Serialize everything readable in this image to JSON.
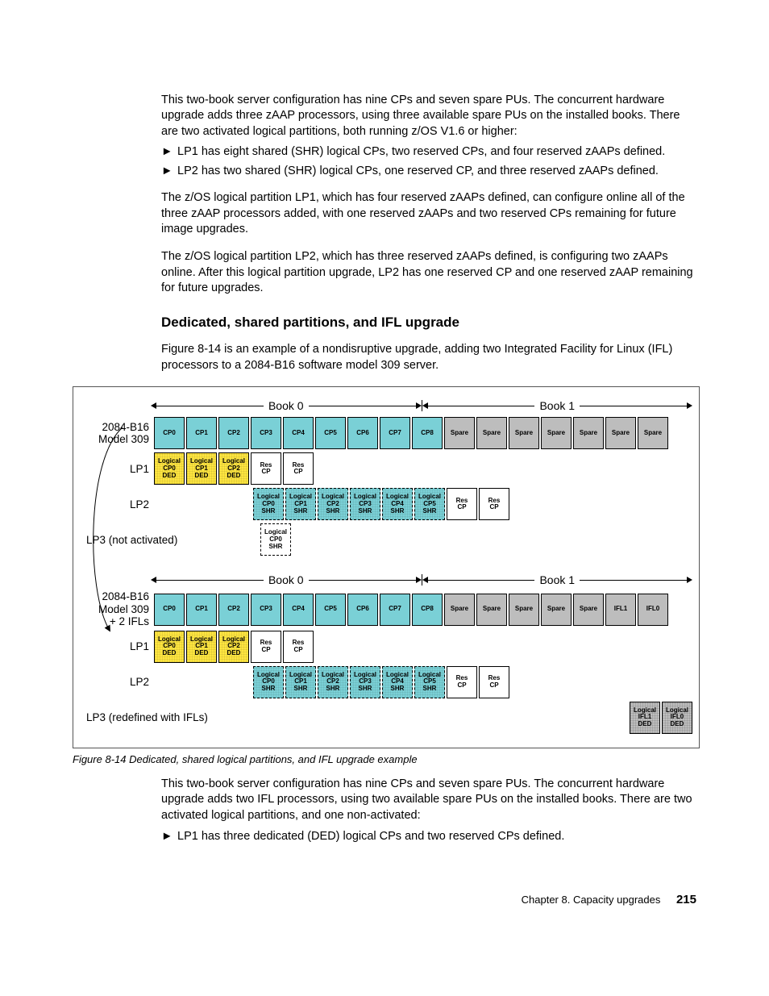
{
  "paragraphs": {
    "intro": "This two-book server configuration has nine CPs and seven spare PUs. The concurrent hardware upgrade adds three zAAP processors, using three available spare PUs on the installed books. There are two activated logical partitions, both running z/OS V1.6 or higher:",
    "bullet1": "LP1 has eight shared (SHR) logical CPs, two reserved CPs, and four reserved zAAPs defined.",
    "bullet2": "LP2 has two shared (SHR) logical CPs, one reserved CP, and three reserved zAAPs defined.",
    "lp1_para": "The z/OS logical partition LP1, which has four reserved zAAPs defined, can configure online all of the three zAAP processors added, with one reserved zAAPs and two reserved CPs remaining for future image upgrades.",
    "lp2_para": "The z/OS logical partition LP2, which has three reserved zAAPs defined, is configuring two zAAPs online. After this logical partition upgrade, LP2 has one reserved CP and one reserved zAAP remaining for future upgrades.",
    "section_heading": "Dedicated, shared partitions, and IFL upgrade",
    "section_para": "Figure 8-14 is an example of a nondisruptive upgrade, adding two Integrated Facility for Linux (IFL) processors to a 2084-B16 software model 309 server.",
    "after_fig_para": "This two-book server configuration has nine CPs and seven spare PUs. The concurrent hardware upgrade adds two IFL processors, using two available spare PUs on the installed books. There are two activated logical partitions, and one non-activated:",
    "after_bullet1": "LP1 has three dedicated (DED) logical CPs and two reserved CPs defined."
  },
  "figure": {
    "caption": "Figure 8-14   Dedicated, shared logical partitions, and IFL upgrade example",
    "books": {
      "b0": "Book 0",
      "b1": "Book 1"
    },
    "topA": {
      "modelLabel": "2084-B16\nModel 309",
      "cps": [
        "CP0",
        "CP1",
        "CP2",
        "CP3",
        "CP4",
        "CP5",
        "CP6",
        "CP7",
        "CP8"
      ],
      "spares": [
        "Spare",
        "Spare",
        "Spare",
        "Spare",
        "Spare",
        "Spare",
        "Spare"
      ],
      "lp1Label": "LP1",
      "lp1": [
        {
          "l1": "Logical",
          "l2": "CP0",
          "l3": "DED",
          "cls": "ded"
        },
        {
          "l1": "Logical",
          "l2": "CP1",
          "l3": "DED",
          "cls": "ded"
        },
        {
          "l1": "Logical",
          "l2": "CP2",
          "l3": "DED",
          "cls": "ded"
        },
        {
          "l1": "Res",
          "l2": "CP",
          "cls": "res"
        },
        {
          "l1": "Res",
          "l2": "CP",
          "cls": "res"
        }
      ],
      "lp2Label": "LP2",
      "lp2": [
        {
          "l1": "Logical",
          "l2": "CP0",
          "l3": "SHR",
          "cls": "shr"
        },
        {
          "l1": "Logical",
          "l2": "CP1",
          "l3": "SHR",
          "cls": "shr"
        },
        {
          "l1": "Logical",
          "l2": "CP2",
          "l3": "SHR",
          "cls": "shr"
        },
        {
          "l1": "Logical",
          "l2": "CP3",
          "l3": "SHR",
          "cls": "shr"
        },
        {
          "l1": "Logical",
          "l2": "CP4",
          "l3": "SHR",
          "cls": "shr"
        },
        {
          "l1": "Logical",
          "l2": "CP5",
          "l3": "SHR",
          "cls": "shr"
        },
        {
          "l1": "Res",
          "l2": "CP",
          "cls": "res"
        },
        {
          "l1": "Res",
          "l2": "CP",
          "cls": "res"
        }
      ],
      "lp3Label": "LP3 (not activated)",
      "lp3": [
        {
          "l1": "Logical",
          "l2": "CP0",
          "l3": "SHR",
          "cls": "shr-only"
        }
      ]
    },
    "topB": {
      "modelLabel": "2084-B16\nModel 309\n+ 2 IFLs",
      "cps": [
        "CP0",
        "CP1",
        "CP2",
        "CP3",
        "CP4",
        "CP5",
        "CP6",
        "CP7",
        "CP8"
      ],
      "spares": [
        "Spare",
        "Spare",
        "Spare",
        "Spare",
        "Spare",
        "IFL1",
        "IFL0"
      ],
      "lp1Label": "LP1",
      "lp1": [
        {
          "l1": "Logical",
          "l2": "CP0",
          "l3": "DED",
          "cls": "ded"
        },
        {
          "l1": "Logical",
          "l2": "CP1",
          "l3": "DED",
          "cls": "ded"
        },
        {
          "l1": "Logical",
          "l2": "CP2",
          "l3": "DED",
          "cls": "ded"
        },
        {
          "l1": "Res",
          "l2": "CP",
          "cls": "res"
        },
        {
          "l1": "Res",
          "l2": "CP",
          "cls": "res"
        }
      ],
      "lp2Label": "LP2",
      "lp2": [
        {
          "l1": "Logical",
          "l2": "CP0",
          "l3": "SHR",
          "cls": "shr"
        },
        {
          "l1": "Logical",
          "l2": "CP1",
          "l3": "SHR",
          "cls": "shr"
        },
        {
          "l1": "Logical",
          "l2": "CP2",
          "l3": "SHR",
          "cls": "shr"
        },
        {
          "l1": "Logical",
          "l2": "CP3",
          "l3": "SHR",
          "cls": "shr"
        },
        {
          "l1": "Logical",
          "l2": "CP4",
          "l3": "SHR",
          "cls": "shr"
        },
        {
          "l1": "Logical",
          "l2": "CP5",
          "l3": "SHR",
          "cls": "shr"
        },
        {
          "l1": "Res",
          "l2": "CP",
          "cls": "res"
        },
        {
          "l1": "Res",
          "l2": "CP",
          "cls": "res"
        }
      ],
      "lp3Label": "LP3 (redefined with IFLs)",
      "lp3": [
        {
          "l1": "Logical",
          "l2": "IFL1",
          "l3": "DED",
          "cls": "ifl-ded"
        },
        {
          "l1": "Logical",
          "l2": "IFL0",
          "l3": "DED",
          "cls": "ifl-ded"
        }
      ]
    }
  },
  "footer": {
    "chapter": "Chapter 8. Capacity upgrades",
    "page": "215"
  }
}
